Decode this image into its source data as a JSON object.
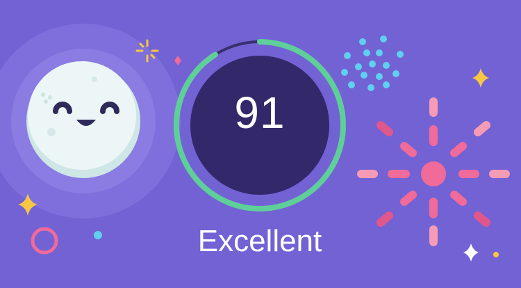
{
  "score": {
    "value": 91,
    "max": 100,
    "label": "Excellent"
  },
  "colors": {
    "background": "#7262d4",
    "ring_progress": "#5fcf9a",
    "ring_track": "#3a2f6e",
    "dial_fill": "#33286a",
    "mascot_face": "#e9f3f3",
    "confetti_pink": "#f06a9a",
    "confetti_blue": "#5fd0f0",
    "sparkle_yellow": "#f7c744"
  },
  "icons": {
    "mascot": "smiling-moon-mascot",
    "decorations": [
      "sparkle-icon",
      "firework-icon",
      "confetti-dots-icon",
      "ring-icon"
    ]
  }
}
